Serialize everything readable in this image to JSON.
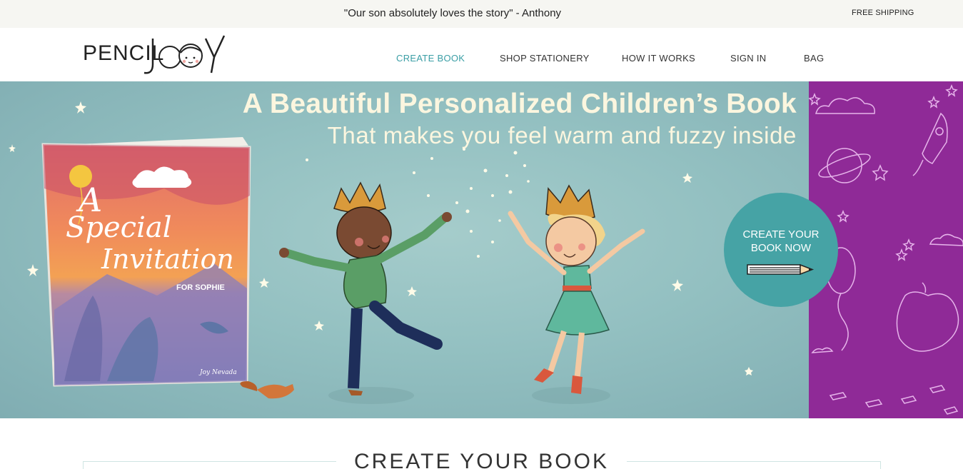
{
  "announcement": {
    "quote": "\"Our son absolutely loves the story\" - Anthony",
    "shipping": "FREE SHIPPING"
  },
  "brand": {
    "logo_text_left": "PENCIL",
    "logo_text_right": "J",
    "logo_text_end": "Y"
  },
  "nav": {
    "create_book": "CREATE BOOK",
    "shop_stationery": "SHOP STATIONERY",
    "how_it_works": "HOW IT WORKS",
    "sign_in": "SIGN IN",
    "bag": "BAG"
  },
  "hero": {
    "title": "A Beautiful Personalized Children’s Book",
    "subtitle": "That makes you feel warm and fuzzy inside",
    "book": {
      "title_line1": "A",
      "title_line2": "Special",
      "title_line3": "Invitation",
      "for_name": "FOR SOPHIE",
      "signature": "Joy Nevada"
    },
    "cta": {
      "line1": "CREATE YOUR",
      "line2": "BOOK NOW"
    }
  },
  "section": {
    "title": "CREATE YOUR BOOK"
  },
  "colors": {
    "accent": "#46a3a5",
    "side_panel": "#8f2a97",
    "hero_bg": "#93c0c1",
    "headline": "#fbf6df"
  }
}
